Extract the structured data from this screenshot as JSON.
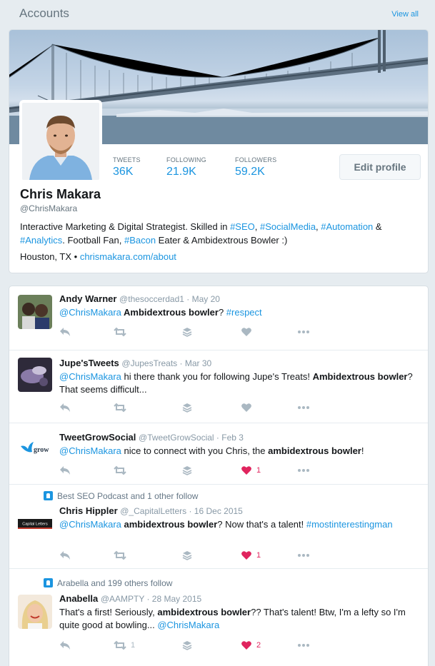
{
  "header": {
    "title": "Accounts",
    "view_all": "View all"
  },
  "profile": {
    "stats": [
      {
        "label": "TWEETS",
        "value": "36K"
      },
      {
        "label": "FOLLOWING",
        "value": "21.9K"
      },
      {
        "label": "FOLLOWERS",
        "value": "59.2K"
      }
    ],
    "edit_label": "Edit profile",
    "name": "Chris Makara",
    "handle": "@ChrisMakara",
    "bio": {
      "t1": "Interactive Marketing & Digital Strategist. Skilled in ",
      "h1": "#SEO",
      "t2": ", ",
      "h2": "#SocialMedia",
      "t3": ", ",
      "h3": "#Automation",
      "t4": " & ",
      "h4": "#Analytics",
      "t5": ". Football Fan, ",
      "h5": "#Bacon",
      "t6": " Eater & Ambidextrous Bowler :)"
    },
    "location": "Houston, TX",
    "location_sep": " • ",
    "url": "chrismakara.com/about"
  },
  "tweets": [
    {
      "name": "Andy Warner",
      "meta": "@thesoccerdad1 · May 20",
      "text": {
        "mention": "@ChrisMakara",
        "bold": " Ambidextrous bowler",
        "rest": "? ",
        "hashtag": "#respect"
      },
      "retweets": "",
      "likes": "",
      "liked": false
    },
    {
      "name": "Jupe'sTweets",
      "meta": "@JupesTreats · Mar 30",
      "text": {
        "mention": "@ChrisMakara",
        "pre": " hi there thank you for following Jupe's Treats!  ",
        "bold": "Ambidextrous bowler",
        "rest": "? That seems difficult..."
      },
      "retweets": "",
      "likes": "",
      "liked": false
    },
    {
      "name": "TweetGrowSocial",
      "meta": "@TweetGrowSocial · Feb 3",
      "logo_text": "grow",
      "text": {
        "mention": "@ChrisMakara",
        "pre": " nice to connect with you Chris, the ",
        "bold": "ambidextrous bowler",
        "rest": "!"
      },
      "retweets": "",
      "likes": "1",
      "liked": true
    },
    {
      "context": "Best SEO Podcast and 1 other follow",
      "name": "Chris Hippler",
      "meta": "@_CapitalLetters · 16 Dec 2015",
      "logo_text": "Capital Letters",
      "text": {
        "mention": "@ChrisMakara",
        "pre": " ",
        "bold": "ambidextrous bowler",
        "rest": "? Now that's a talent! ",
        "hashtag": "#mostinterestingman"
      },
      "retweets": "",
      "likes": "1",
      "liked": true
    },
    {
      "context": "Arabella and 199 others follow",
      "name": "Anabella",
      "meta": "@AAMPTY · 28 May 2015",
      "text": {
        "pre": "That's a first! Seriously, ",
        "bold": "ambidextrous bowler",
        "rest": "?? That's talent! Btw, I'm a lefty so I'm quite good at bowling... ",
        "mention": "@ChrisMakara"
      },
      "retweets": "1",
      "likes": "2",
      "liked": true
    }
  ],
  "colors": {
    "accent": "#1b95e0",
    "like": "#e0245e",
    "muted": "#aab8c2",
    "page_bg": "#e6ecf0"
  },
  "icons": [
    "reply-icon",
    "retweet-icon",
    "stack-icon",
    "heart-icon",
    "more-icon",
    "user-follow-icon"
  ]
}
